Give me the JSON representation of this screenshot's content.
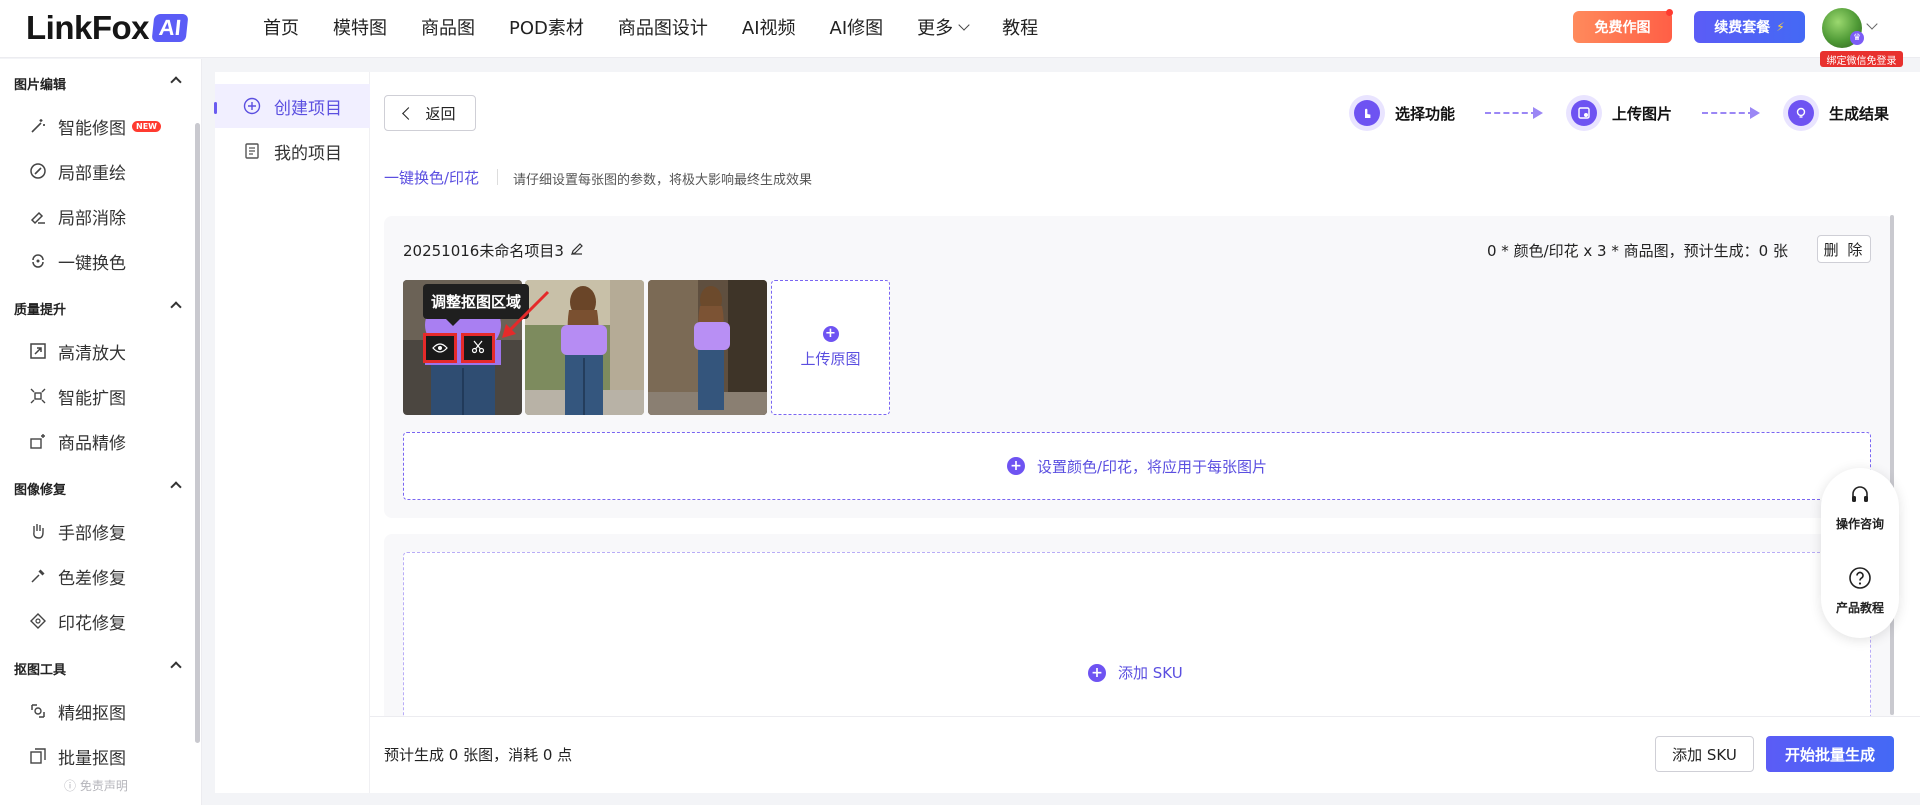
{
  "header": {
    "logo_text": "LinkFox",
    "logo_badge": "AI",
    "nav": [
      {
        "label": "首页"
      },
      {
        "label": "模特图"
      },
      {
        "label": "商品图"
      },
      {
        "label": "POD素材"
      },
      {
        "label": "商品图设计"
      },
      {
        "label": "AI视频"
      },
      {
        "label": "AI修图"
      },
      {
        "label": "更多"
      },
      {
        "label": "教程"
      }
    ],
    "free_btn": "免费作图",
    "renew_btn": "续费套餐",
    "bind_tip": "绑定微信免登录",
    "accent": "#5b5cf6",
    "free_color": "#ff6a4d"
  },
  "sidebar": {
    "groups": [
      {
        "title": "图片编辑",
        "items": [
          {
            "label": "智能修图",
            "icon": "magic-wand-icon",
            "badge": "NEW"
          },
          {
            "label": "局部重绘",
            "icon": "brush-circle-icon"
          },
          {
            "label": "局部消除",
            "icon": "eraser-icon"
          },
          {
            "label": "一键换色",
            "icon": "color-swap-icon"
          }
        ]
      },
      {
        "title": "质量提升",
        "items": [
          {
            "label": "高清放大",
            "icon": "expand-icon"
          },
          {
            "label": "智能扩图",
            "icon": "outpaint-icon"
          },
          {
            "label": "商品精修",
            "icon": "retouch-icon"
          }
        ]
      },
      {
        "title": "图像修复",
        "items": [
          {
            "label": "手部修复",
            "icon": "hand-icon"
          },
          {
            "label": "色差修复",
            "icon": "dropper-icon"
          },
          {
            "label": "印花修复",
            "icon": "pattern-icon"
          }
        ]
      },
      {
        "title": "抠图工具",
        "items": [
          {
            "label": "精细抠图",
            "icon": "cutout-icon"
          },
          {
            "label": "批量抠图",
            "icon": "batch-cutout-icon"
          }
        ]
      }
    ],
    "disclaimer": "免责声明"
  },
  "panel2": {
    "items": [
      {
        "label": "创建项目",
        "icon": "plus-circle-icon",
        "active": true
      },
      {
        "label": "我的项目",
        "icon": "document-list-icon",
        "active": false
      }
    ]
  },
  "main": {
    "back_label": "返回",
    "steps": [
      {
        "label": "选择功能",
        "icon": "pointer-icon"
      },
      {
        "label": "上传图片",
        "icon": "upload-image-icon"
      },
      {
        "label": "生成结果",
        "icon": "bulb-icon"
      }
    ],
    "mode_tab": "一键换色/印花",
    "mode_desc": "请仔细设置每张图的参数，将极大影响最终生成效果",
    "project": {
      "name": "20251016未命名项目3",
      "summary": "0 * 颜色/印花 x 3 * 商品图，预计生成：0 张",
      "delete_label": "删 除"
    },
    "tooltip": "调整抠图区域",
    "upload_label": "上传原图",
    "color_setting": "设置颜色/印花，将应用于每张图片",
    "add_sku_inner": "添加 SKU"
  },
  "float": {
    "items": [
      {
        "label": "操作咨询",
        "icon": "headset-icon"
      },
      {
        "label": "产品教程",
        "icon": "help-circle-icon"
      }
    ]
  },
  "footer": {
    "estimate": "预计生成 0 张图，消耗 0 点",
    "add_sku": "添加 SKU",
    "start": "开始批量生成"
  }
}
